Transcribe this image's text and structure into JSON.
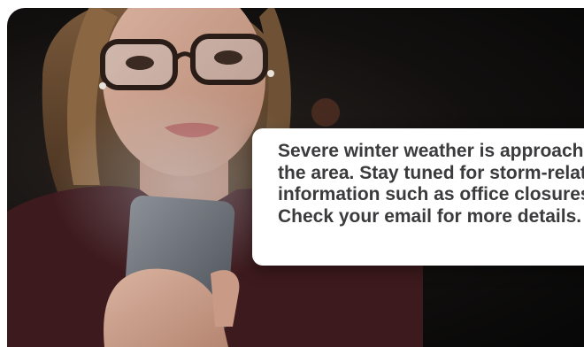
{
  "notification": {
    "lines": [
      "Severe winter weather is approaching",
      "the area. Stay tuned for storm-related",
      "information such as office closures.",
      "Check your email for more details."
    ]
  },
  "colors": {
    "background": "#0e0c0b",
    "card": "#ffffff",
    "text": "#3b3b3d"
  }
}
